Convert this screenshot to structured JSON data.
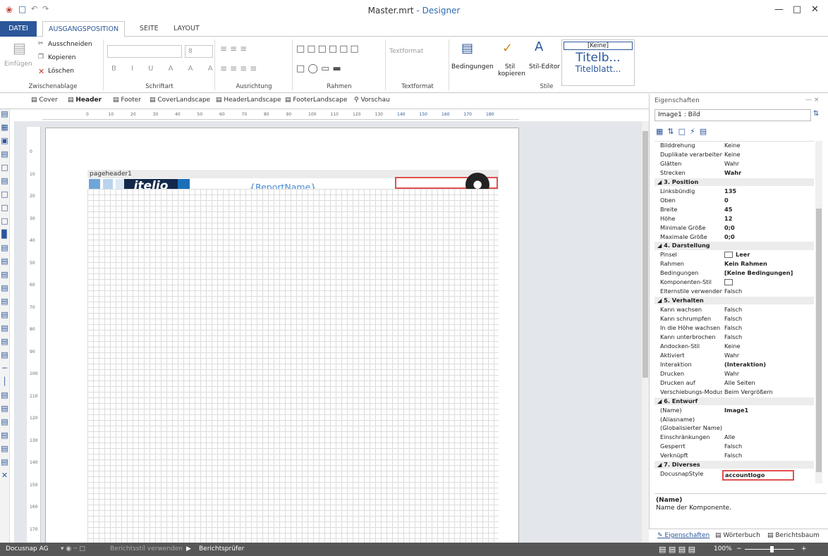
{
  "window": {
    "title": "Master.mrt",
    "title_sub": "- Designer"
  },
  "ribbon_tabs": [
    "DATEI",
    "AUSGANGSPOSITION",
    "SEITE",
    "LAYOUT"
  ],
  "ribbon": {
    "clipboard": {
      "paste": "Einfügen",
      "cut": "Ausschneiden",
      "copy": "Kopieren",
      "delete": "Löschen",
      "group": "Zwischenablage"
    },
    "font": {
      "group": "Schriftart",
      "size": "8"
    },
    "alignment": {
      "group": "Ausrichtung"
    },
    "borders": {
      "group": "Rahmen"
    },
    "textformat": {
      "label": "Textformat",
      "group": "Textformat"
    },
    "styles": {
      "conditions": "Bedingungen",
      "copy_style": "Stil kopieren",
      "style_editor": "Stil-Editor",
      "none": "[Keine]",
      "preview1": "Titelb...",
      "preview2": "Titelblatt...",
      "group": "Stile"
    }
  },
  "doc_tabs": [
    "Cover",
    "Header",
    "Footer",
    "CoverLandscape",
    "HeaderLandscape",
    "FooterLandscape",
    "Vorschau"
  ],
  "ruler_h": [
    "0",
    "10",
    "20",
    "30",
    "40",
    "50",
    "60",
    "70",
    "80",
    "90",
    "100",
    "110",
    "120",
    "130",
    "140",
    "150",
    "160",
    "170",
    "180"
  ],
  "ruler_v": [
    "0",
    "10",
    "20",
    "30",
    "40",
    "50",
    "60",
    "70",
    "80",
    "90",
    "100",
    "110",
    "120",
    "130",
    "140",
    "150",
    "160",
    "170"
  ],
  "band": {
    "title": "pageheader1",
    "logo_text": "itelio",
    "report_name": "{ReportName}"
  },
  "properties": {
    "header": "Eigenschaften",
    "pin": "— ×",
    "selected": "Image1 : Bild",
    "desc_title": "(Name)",
    "desc_text": "Name der Komponente.",
    "rows": [
      {
        "n": "Bilddrehung",
        "v": "Keine"
      },
      {
        "n": "Duplikate verarbeiten",
        "v": "Keine"
      },
      {
        "n": "Glätten",
        "v": "Wahr"
      },
      {
        "n": "Strecken",
        "v": "Wahr",
        "b": true
      },
      {
        "cat": "3. Position"
      },
      {
        "n": "Linksbündig",
        "v": "135",
        "b": true
      },
      {
        "n": "Oben",
        "v": "0",
        "b": true
      },
      {
        "n": "Breite",
        "v": "45",
        "b": true
      },
      {
        "n": "Höhe",
        "v": "12",
        "b": true
      },
      {
        "n": "Minimale Größe",
        "v": "0;0",
        "b": true
      },
      {
        "n": "Maximale Größe",
        "v": "0;0",
        "b": true
      },
      {
        "cat": "4. Darstellung"
      },
      {
        "n": "Pinsel",
        "v": "Leer",
        "b": true,
        "swatch": true
      },
      {
        "n": "Rahmen",
        "v": "Kein Rahmen",
        "b": true
      },
      {
        "n": "Bedingungen",
        "v": "[Keine Bedingungen]",
        "b": true
      },
      {
        "n": "Komponenten-Stil",
        "v": "",
        "swatch": true
      },
      {
        "n": "Elternstile verwenden",
        "v": "Falsch"
      },
      {
        "cat": "5. Verhalten"
      },
      {
        "n": "Kann wachsen",
        "v": "Falsch"
      },
      {
        "n": "Kann schrumpfen",
        "v": "Falsch"
      },
      {
        "n": "In die Höhe wachsen",
        "v": "Falsch"
      },
      {
        "n": "Kann unterbrochen",
        "v": "Falsch"
      },
      {
        "n": "Andocken-Stil",
        "v": "Keine"
      },
      {
        "n": "Aktiviert",
        "v": "Wahr"
      },
      {
        "n": "Interaktion",
        "v": "(Interaktion)",
        "b": true
      },
      {
        "n": "Drucken",
        "v": "Wahr"
      },
      {
        "n": "Drucken auf",
        "v": "Alle Seiten"
      },
      {
        "n": "Verschiebungs-Modus",
        "v": "Beim Vergrößern"
      },
      {
        "cat": "6. Entwurf"
      },
      {
        "n": "(Name)",
        "v": "Image1",
        "b": true
      },
      {
        "n": "(Aliasname)",
        "v": ""
      },
      {
        "n": "(Globalisierter Name)",
        "v": ""
      },
      {
        "n": "Einschränkungen",
        "v": "Alle"
      },
      {
        "n": "Gesperrt",
        "v": "Falsch"
      },
      {
        "n": "Verknüpft",
        "v": "Falsch"
      },
      {
        "cat": "7. Diverses"
      },
      {
        "n": "DocusnapStyle",
        "v": "accountlogo",
        "b": true,
        "hl": true
      }
    ],
    "tabs": [
      "Eigenschaften",
      "Wörterbuch",
      "Berichtsbaum"
    ]
  },
  "status": {
    "left": "Docusnap AG",
    "use_style": "Berichtsstil verwenden",
    "checker": "Berichtsprüfer",
    "zoom": "100%"
  },
  "colors": {
    "accent": "#2b579a",
    "selection": "#e05050",
    "logo_blue": "#1a6fb8"
  }
}
